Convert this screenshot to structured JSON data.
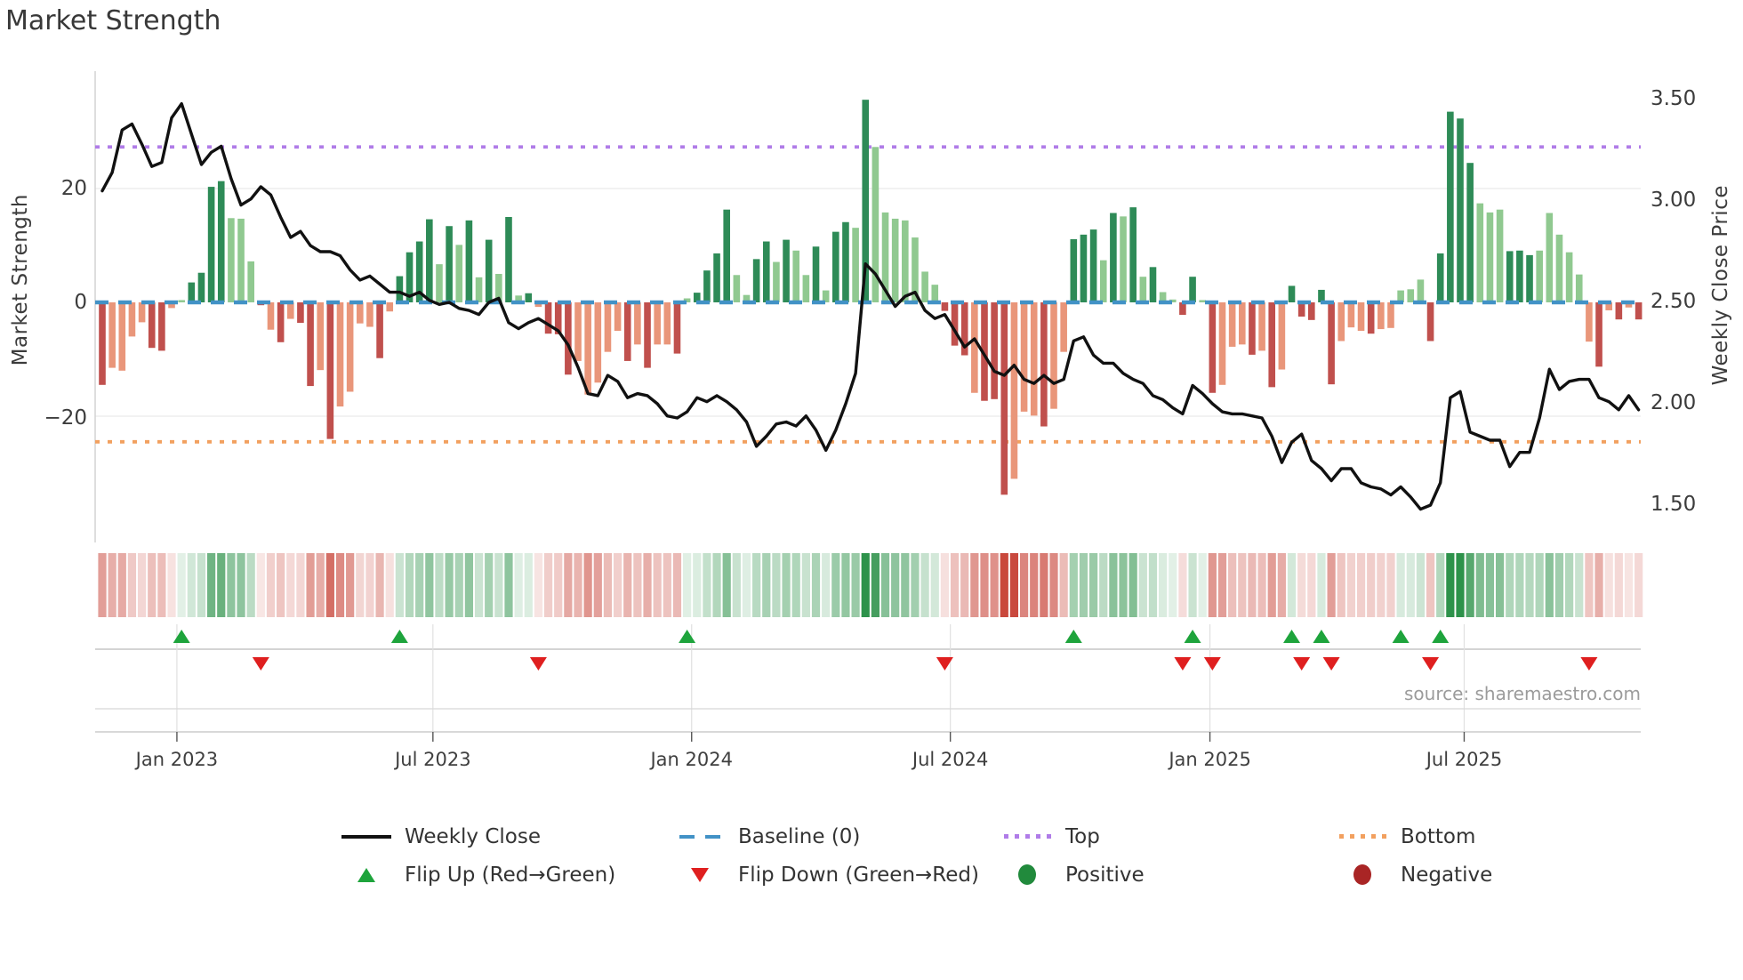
{
  "title": "Market Strength",
  "source_text": "source: sharemaestro.com",
  "axes": {
    "left_label": "Market Strength",
    "right_label": "Weekly Close Price",
    "left_ticks": [
      {
        "value": 20,
        "label": "20"
      },
      {
        "value": 0,
        "label": "0"
      },
      {
        "value": -20,
        "label": "−20"
      }
    ],
    "right_ticks": [
      {
        "price": 3.5,
        "label": "3.50"
      },
      {
        "price": 3.0,
        "label": "3.00"
      },
      {
        "price": 2.5,
        "label": "2.50"
      },
      {
        "price": 2.0,
        "label": "2.00"
      },
      {
        "price": 1.5,
        "label": "1.50"
      }
    ],
    "x_ticks": [
      {
        "week": 7.53,
        "label": "Jan 2023"
      },
      {
        "week": 33.36,
        "label": "Jul 2023"
      },
      {
        "week": 59.46,
        "label": "Jan 2024"
      },
      {
        "week": 85.56,
        "label": "Jul 2024"
      },
      {
        "week": 111.75,
        "label": "Jan 2025"
      },
      {
        "week": 137.4,
        "label": "Jul 2025"
      }
    ]
  },
  "chart_data": {
    "type": "bar+line",
    "x_unit": "week",
    "x_range_labels": [
      "Jan 2023",
      "Jul 2023",
      "Jan 2024",
      "Jul 2024",
      "Jan 2025",
      "Jul 2025"
    ],
    "baseline": 0,
    "top_threshold": 27.3,
    "bottom_threshold": -24.5,
    "ylim_strength": [
      -42,
      41
    ],
    "ylim_price": [
      1.36,
      3.64
    ],
    "legend_position": "bottom",
    "series": [
      {
        "name": "Market Strength bars",
        "axis": "left"
      },
      {
        "name": "Weekly Close",
        "axis": "right"
      }
    ],
    "strength_values": [
      -14.5,
      -11.5,
      -12,
      -6,
      -3.5,
      -8,
      -8.5,
      -1,
      0.4,
      3.5,
      5.2,
      20.3,
      21.3,
      14.8,
      14.7,
      7.2,
      -0.5,
      -4.8,
      -7,
      -2.9,
      -3.6,
      -14.7,
      -11.9,
      -24,
      -18.3,
      -15.7,
      -3.7,
      -4.3,
      -9.8,
      -1.6,
      4.6,
      8.8,
      10.7,
      14.6,
      6.7,
      13.4,
      10.1,
      14.4,
      4.4,
      11,
      5,
      15,
      1.2,
      1.6,
      -0.8,
      -5.5,
      -5.6,
      -12.7,
      -10.3,
      -16.2,
      -14.1,
      -8.7,
      -5,
      -10.3,
      -7.4,
      -11.5,
      -7.4,
      -7.4,
      -9,
      0.7,
      1.7,
      5.6,
      8.6,
      16.3,
      4.8,
      1.3,
      7.6,
      10.7,
      7.1,
      11,
      9.1,
      4.8,
      9.8,
      2.1,
      12.4,
      14.1,
      13.1,
      35.6,
      27.3,
      15.8,
      14.7,
      14.4,
      11.4,
      5.4,
      3.1,
      -1.5,
      -7.6,
      -9.3,
      -15.9,
      -17.3,
      -17,
      -33.8,
      -31,
      -19.2,
      -19.9,
      -21.8,
      -18.7,
      -8.7,
      11.1,
      11.9,
      12.8,
      7.4,
      15.7,
      15.1,
      16.7,
      4.5,
      6.2,
      1.8,
      0.5,
      -2.2,
      4.5,
      0.4,
      -15.9,
      -14.5,
      -7.8,
      -7.4,
      -9.2,
      -8.5,
      -14.9,
      -11.8,
      2.9,
      -2.5,
      -3.1,
      2.2,
      -14.4,
      -6.8,
      -4.4,
      -5,
      -5.5,
      -4.7,
      -4.5,
      2.1,
      2.3,
      4,
      -6.8,
      8.6,
      33.5,
      32.3,
      24.5,
      17.4,
      15.8,
      16.3,
      9,
      9.1,
      8.3,
      9.1,
      15.7,
      11.9,
      8.8,
      4.9,
      -6.9,
      -11.3,
      -1.4,
      -3,
      -0.9,
      -3
    ],
    "bar_shades": "dllllddllddddllldldlddldlllldlddddldldldldldldddllllldldlldlddddllddldlldlddldllllllldddldddllldlldddldldldllddldllldldldddddllldllllldddddllldddlllllldldldld",
    "weekly_close": [
      3.05,
      3.14,
      3.35,
      3.38,
      3.28,
      3.17,
      3.19,
      3.41,
      3.48,
      3.33,
      3.18,
      3.24,
      3.27,
      3.11,
      2.98,
      3.01,
      3.07,
      3.03,
      2.92,
      2.82,
      2.85,
      2.78,
      2.75,
      2.75,
      2.73,
      2.66,
      2.61,
      2.63,
      2.59,
      2.55,
      2.55,
      2.53,
      2.55,
      2.51,
      2.49,
      2.5,
      2.47,
      2.46,
      2.44,
      2.5,
      2.52,
      2.4,
      2.37,
      2.4,
      2.42,
      2.39,
      2.36,
      2.29,
      2.18,
      2.05,
      2.04,
      2.14,
      2.11,
      2.03,
      2.05,
      2.04,
      2.0,
      1.94,
      1.93,
      1.96,
      2.03,
      2.01,
      2.04,
      2.01,
      1.97,
      1.91,
      1.79,
      1.84,
      1.9,
      1.91,
      1.89,
      1.94,
      1.87,
      1.77,
      1.87,
      2.0,
      2.15,
      2.69,
      2.64,
      2.56,
      2.48,
      2.53,
      2.55,
      2.46,
      2.42,
      2.44,
      2.36,
      2.28,
      2.32,
      2.24,
      2.16,
      2.14,
      2.19,
      2.12,
      2.1,
      2.14,
      2.1,
      2.12,
      2.31,
      2.33,
      2.24,
      2.2,
      2.2,
      2.15,
      2.12,
      2.1,
      2.04,
      2.02,
      1.98,
      1.95,
      2.09,
      2.05,
      2.0,
      1.96,
      1.95,
      1.95,
      1.94,
      1.93,
      1.84,
      1.71,
      1.81,
      1.85,
      1.72,
      1.68,
      1.62,
      1.68,
      1.68,
      1.61,
      1.59,
      1.58,
      1.55,
      1.59,
      1.54,
      1.48,
      1.5,
      1.61,
      2.03,
      2.06,
      1.86,
      1.84,
      1.82,
      1.82,
      1.69,
      1.76,
      1.76,
      1.93,
      2.17,
      2.07,
      2.11,
      2.12,
      2.12,
      2.03,
      2.01,
      1.97,
      2.04,
      1.97
    ],
    "flip_up_weeks": [
      8,
      30,
      59,
      98,
      110,
      120,
      123,
      131,
      135
    ],
    "flip_down_weeks": [
      16,
      44,
      85,
      109,
      112,
      121,
      124,
      134,
      150
    ],
    "heatmap": "same weeks as strength_values, color intensity proportional to |value|"
  },
  "colors": {
    "pos_dark": "#2e8b57",
    "pos_light": "#90c990",
    "neg_dark": "#c0504d",
    "neg_light": "#e9967a",
    "baseline": "#4292c6",
    "top_line": "#b07ce8",
    "bottom_line": "#f2a05f",
    "price_line": "#111111",
    "flip_up": "#1ea43c",
    "flip_down": "#df1f1f",
    "heat_green": "34,140,64",
    "heat_red": "198,62,50",
    "grid": "#ededed",
    "spine": "#d0d0d0"
  },
  "legend": {
    "items": [
      {
        "label": "Weekly Close"
      },
      {
        "label": "Baseline (0)"
      },
      {
        "label": "Top"
      },
      {
        "label": "Bottom"
      },
      {
        "label": "Flip Up (Red→Green)"
      },
      {
        "label": "Flip Down (Green→Red)"
      },
      {
        "label": "Positive"
      },
      {
        "label": "Negative"
      }
    ]
  }
}
